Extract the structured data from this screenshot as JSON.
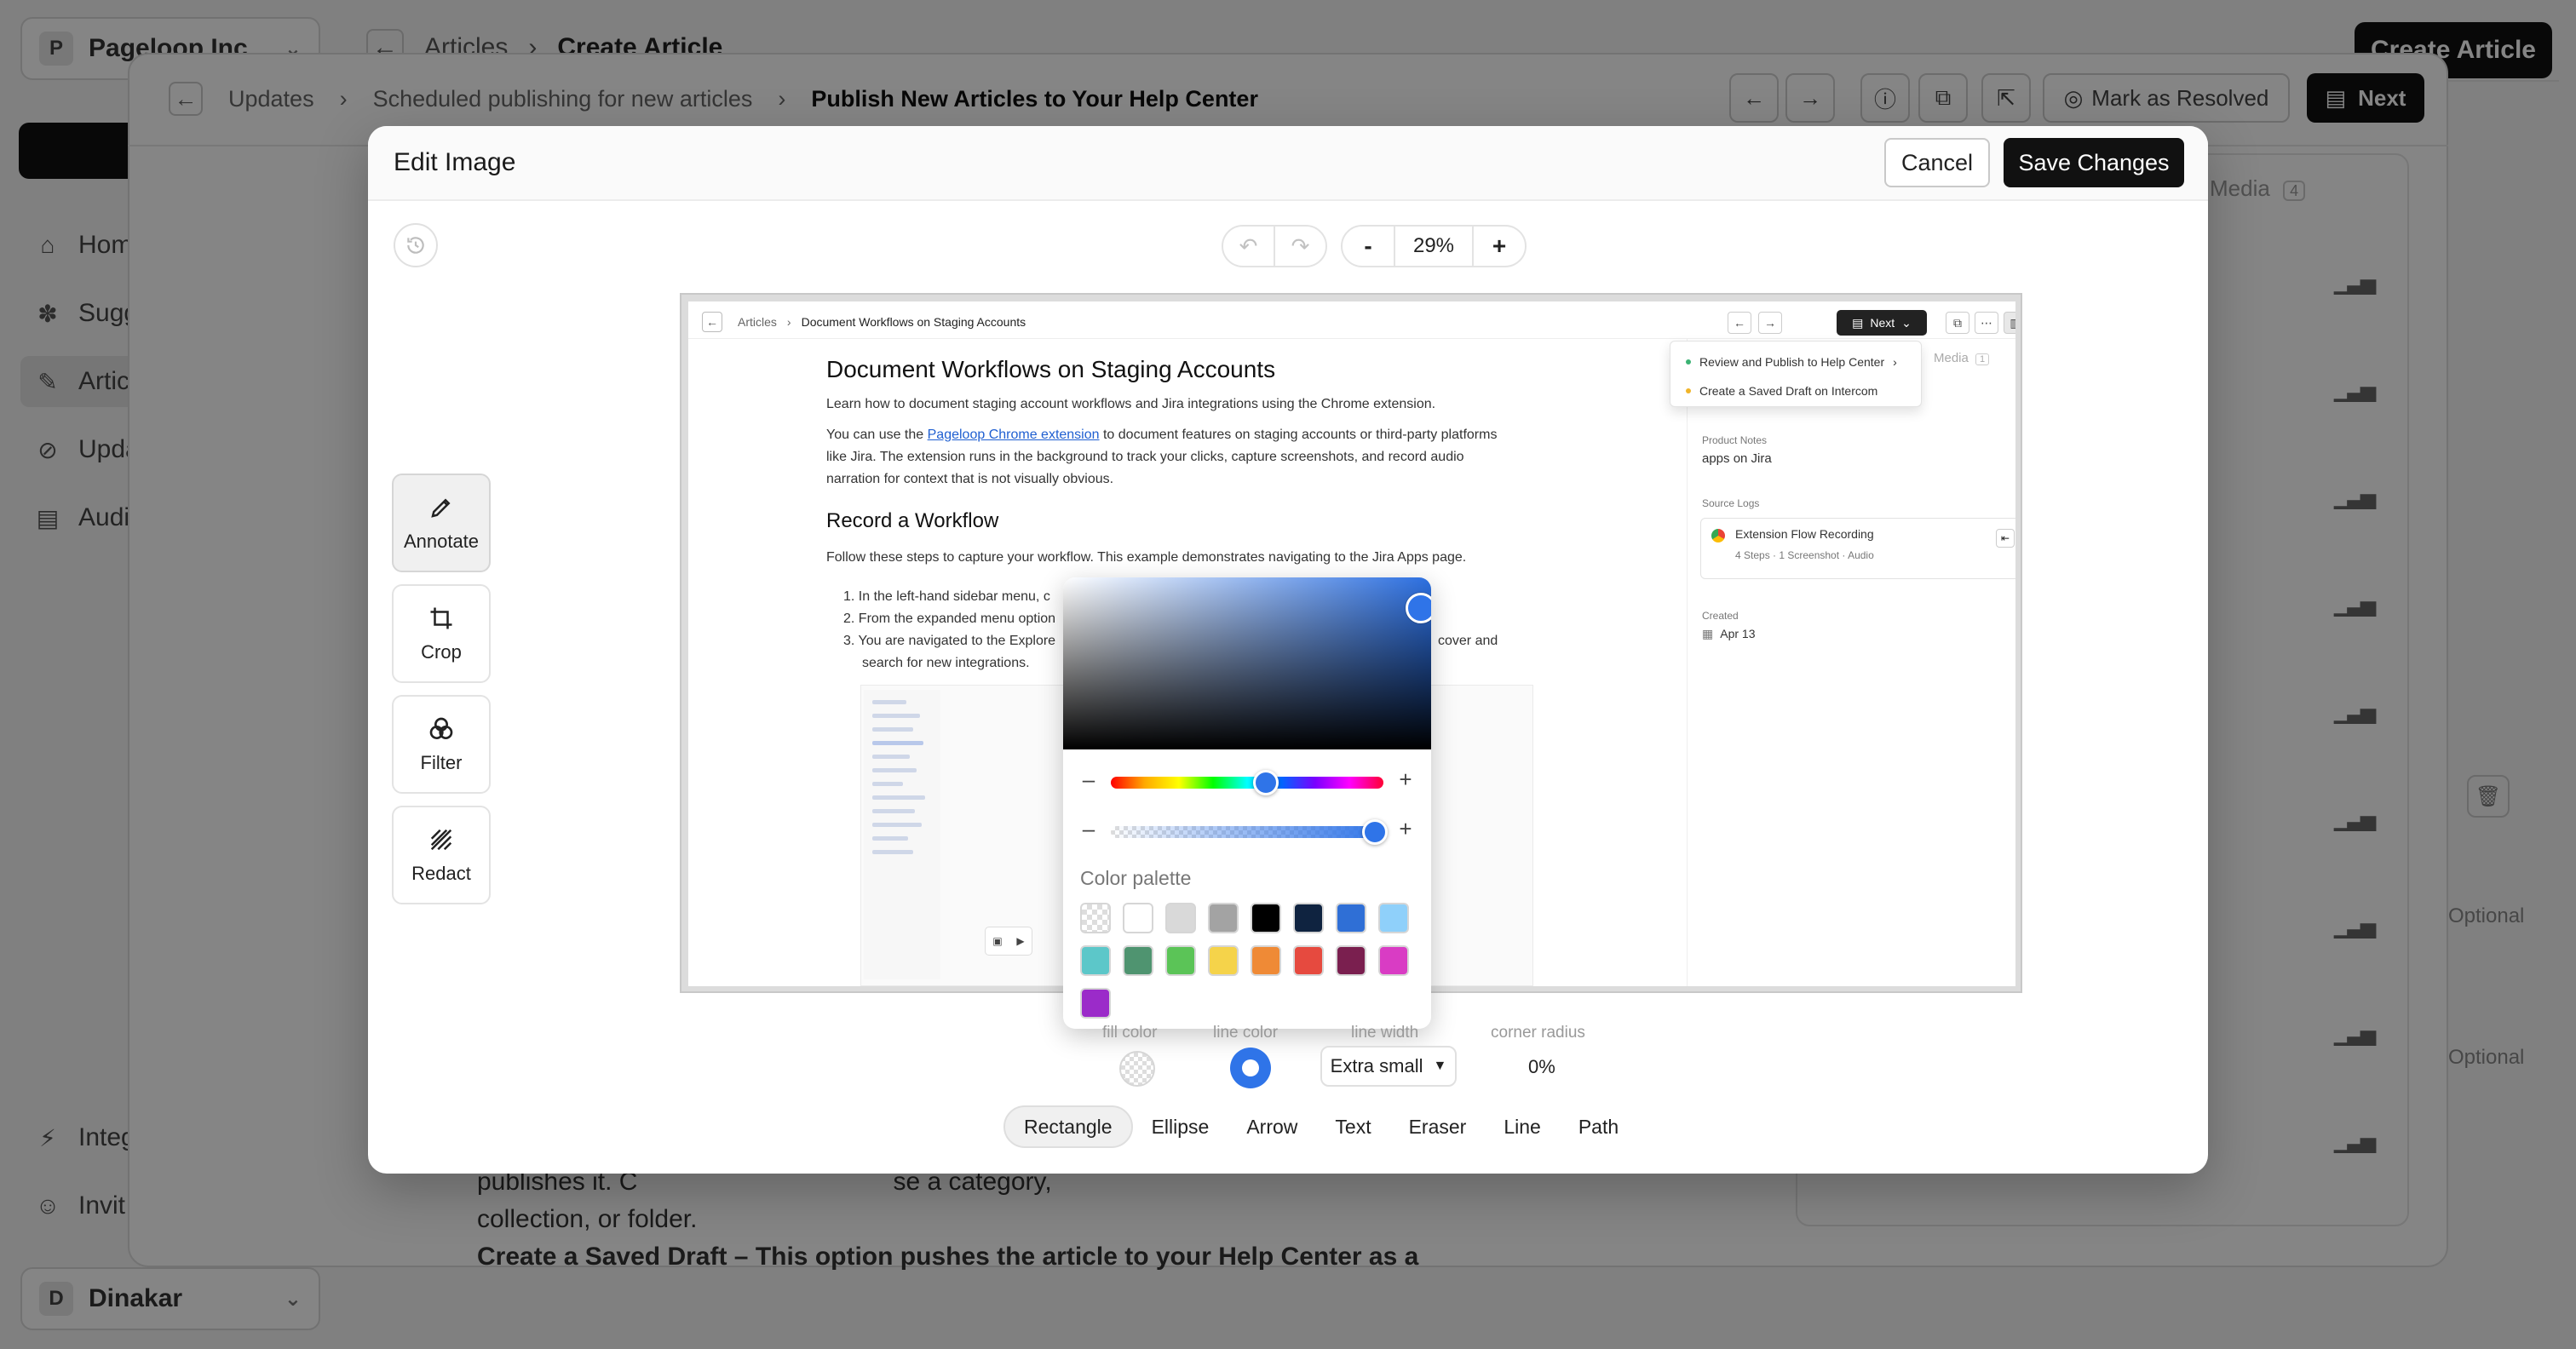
{
  "background": {
    "workspace": {
      "initial": "P",
      "name": "Pageloop Inc"
    },
    "sidebar_items": [
      {
        "label": "Hom",
        "icon": "home-icon"
      },
      {
        "label": "Sugg",
        "icon": "puzzle-icon"
      },
      {
        "label": "Artic",
        "icon": "articles-icon"
      },
      {
        "label": "Upda",
        "icon": "updates-icon"
      },
      {
        "label": "Audi",
        "icon": "audit-icon"
      },
      {
        "label": "Integ",
        "icon": "bolt-icon"
      },
      {
        "label": "Invit",
        "icon": "invite-icon"
      }
    ],
    "user": {
      "initial": "D",
      "name": "Dinakar"
    },
    "top_breadcrumb": [
      "Articles",
      "Create Article"
    ],
    "create_button": "Create Article",
    "panel_breadcrumb": [
      "Updates",
      "Scheduled publishing for new articles",
      "Publish New Articles to Your Help Center"
    ],
    "mark_resolved": "Mark as Resolved",
    "next_label": "Next",
    "media_tab": "Media",
    "media_count": "4",
    "optional_1": "Optional",
    "optional_2": "Optional",
    "body_lines": [
      "publishes it. C",
      "se a category,",
      "collection, or folder.",
      "Create a Saved Draft – This option pushes the article to your Help Center as a"
    ]
  },
  "modal": {
    "title": "Edit Image",
    "cancel": "Cancel",
    "save": "Save Changes",
    "zoom": "29%",
    "zoom_minus": "-",
    "zoom_plus": "+",
    "tools": [
      {
        "label": "Annotate",
        "icon": "pen-icon",
        "active": true
      },
      {
        "label": "Crop",
        "icon": "crop-icon",
        "active": false
      },
      {
        "label": "Filter",
        "icon": "filter-icon",
        "active": false
      },
      {
        "label": "Redact",
        "icon": "redact-icon",
        "active": false
      }
    ],
    "style": {
      "fill_color_label": "fill color",
      "line_color_label": "line color",
      "line_width_label": "line width",
      "corner_radius_label": "corner radius",
      "line_width_value": "Extra small",
      "corner_radius_value": "0%",
      "line_color": "#2f74e8"
    },
    "shapes": [
      {
        "label": "Rectangle",
        "active": true
      },
      {
        "label": "Ellipse",
        "active": false
      },
      {
        "label": "Arrow",
        "active": false
      },
      {
        "label": "Text",
        "active": false
      },
      {
        "label": "Eraser",
        "active": false
      },
      {
        "label": "Line",
        "active": false
      },
      {
        "label": "Path",
        "active": false
      }
    ]
  },
  "picker": {
    "palette_label": "Color palette",
    "current_color": "#2f74e8",
    "hue_position": 0.57,
    "alpha_position": 1.0,
    "minus": "–",
    "plus": "+",
    "swatches": [
      "transparent",
      "#ffffff",
      "#d9d9d9",
      "#a3a3a3",
      "#000000",
      "#0f2340",
      "#2f6fd6",
      "#8fd0fa",
      "#5cc7c9",
      "#4f9470",
      "#5bc457",
      "#f5d34a",
      "#ef8a36",
      "#e64a3f",
      "#7a1f4f",
      "#d93cc4",
      "#9b2bc9"
    ]
  },
  "preview": {
    "breadcrumb_root": "Articles",
    "breadcrumb_current": "Document Workflows on Staging Accounts",
    "next": "Next",
    "title": "Document Workflows on Staging Accounts",
    "intro": "Learn how to document staging account workflows and Jira integrations using the Chrome extension.",
    "para_before_link": "You can use the ",
    "link": "Pageloop Chrome extension",
    "para_after_link": " to document features on staging accounts or third-party platforms like Jira. The extension runs in the background to track your clicks, capture screenshots, and record audio narration for context that is not visually obvious.",
    "h2": "Record a Workflow",
    "steps_intro": "Follow these steps to capture your workflow. This example demonstrates navigating to the Jira Apps page.",
    "steps": [
      "1.  In the left-hand sidebar menu, c",
      "2.  From the expanded menu option",
      "3.  You are navigated to the Explore"
    ],
    "step3_tail": "cover and",
    "step3_line2": "search for new integrations.",
    "dropdown": [
      {
        "label": "Review and Publish to Help Center",
        "dot": "#3bb273"
      },
      {
        "label": "Create a Saved Draft on Intercom",
        "dot": "#f0b429"
      }
    ],
    "media": "Media",
    "media_count": "1",
    "product_notes_label": "Product Notes",
    "product_notes_value": "apps on Jira",
    "source_logs_label": "Source Logs",
    "source_title": "Extension Flow Recording",
    "source_meta": "4 Steps · 1 Screenshot · Audio",
    "created_label": "Created",
    "created_value": "Apr 13"
  }
}
